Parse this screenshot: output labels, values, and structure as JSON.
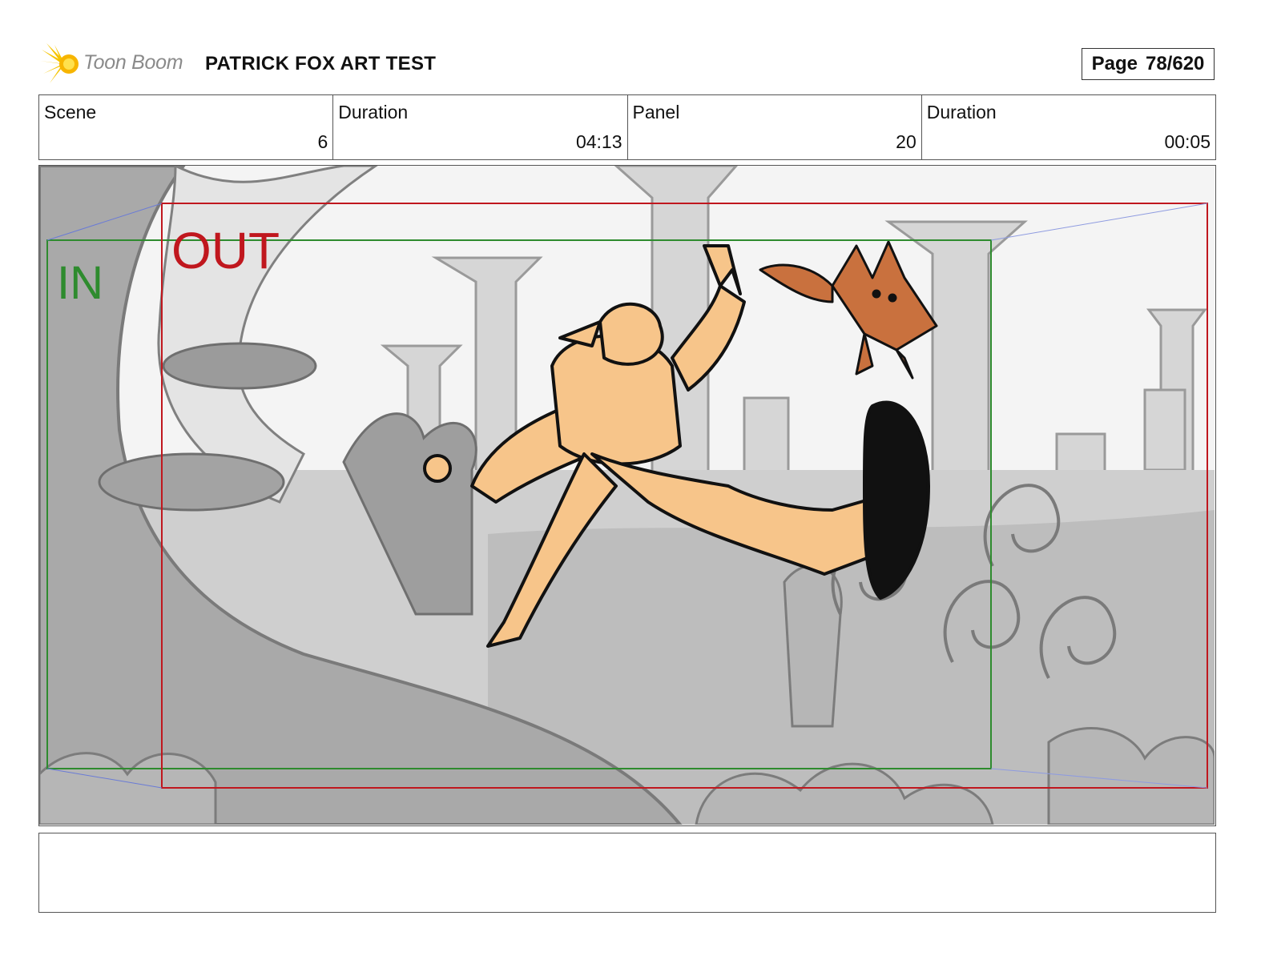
{
  "header": {
    "logo_text": "Toon Boom",
    "title": "PATRICK FOX ART TEST",
    "page_label": "Page",
    "page_value": "78/620"
  },
  "info": [
    {
      "label": "Scene",
      "value": "6"
    },
    {
      "label": "Duration",
      "value": "04:13"
    },
    {
      "label": "Panel",
      "value": "20"
    },
    {
      "label": "Duration",
      "value": "00:05"
    }
  ],
  "panel": {
    "in_label": "IN",
    "out_label": "OUT",
    "in_color": "#2e8b2e",
    "out_color": "#c0171e"
  },
  "caption": ""
}
